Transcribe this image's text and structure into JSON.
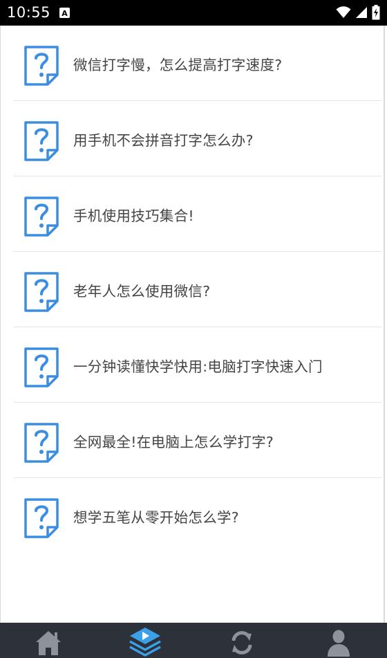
{
  "status_bar": {
    "time": "10:55",
    "notification_icon": "a-notification-icon",
    "right_icons": [
      "wifi-icon",
      "signal-icon",
      "battery-icon"
    ]
  },
  "faq": {
    "icon": "question-document-icon",
    "items": [
      {
        "title": "微信打字慢，怎么提高打字速度?"
      },
      {
        "title": "用手机不会拼音打字怎么办?"
      },
      {
        "title": "手机使用技巧集合!"
      },
      {
        "title": "老年人怎么使用微信?"
      },
      {
        "title": "一分钟读懂快学快用:电脑打字快速入门"
      },
      {
        "title": "全网最全!在电脑上怎么学打字?"
      },
      {
        "title": "想学五笔从零开始怎么学?"
      }
    ]
  },
  "tab_bar": {
    "tabs": [
      {
        "icon": "home-icon"
      },
      {
        "icon": "learn-play-icon",
        "active": true
      },
      {
        "icon": "refresh-icon"
      },
      {
        "icon": "user-icon"
      }
    ]
  },
  "colors": {
    "icon_blue": "#3a8de0",
    "text": "#444444",
    "tab_bar_bg": "#2d3139",
    "tab_icon": "#8e9399",
    "tab_active_icon": "#3aa0e8"
  }
}
